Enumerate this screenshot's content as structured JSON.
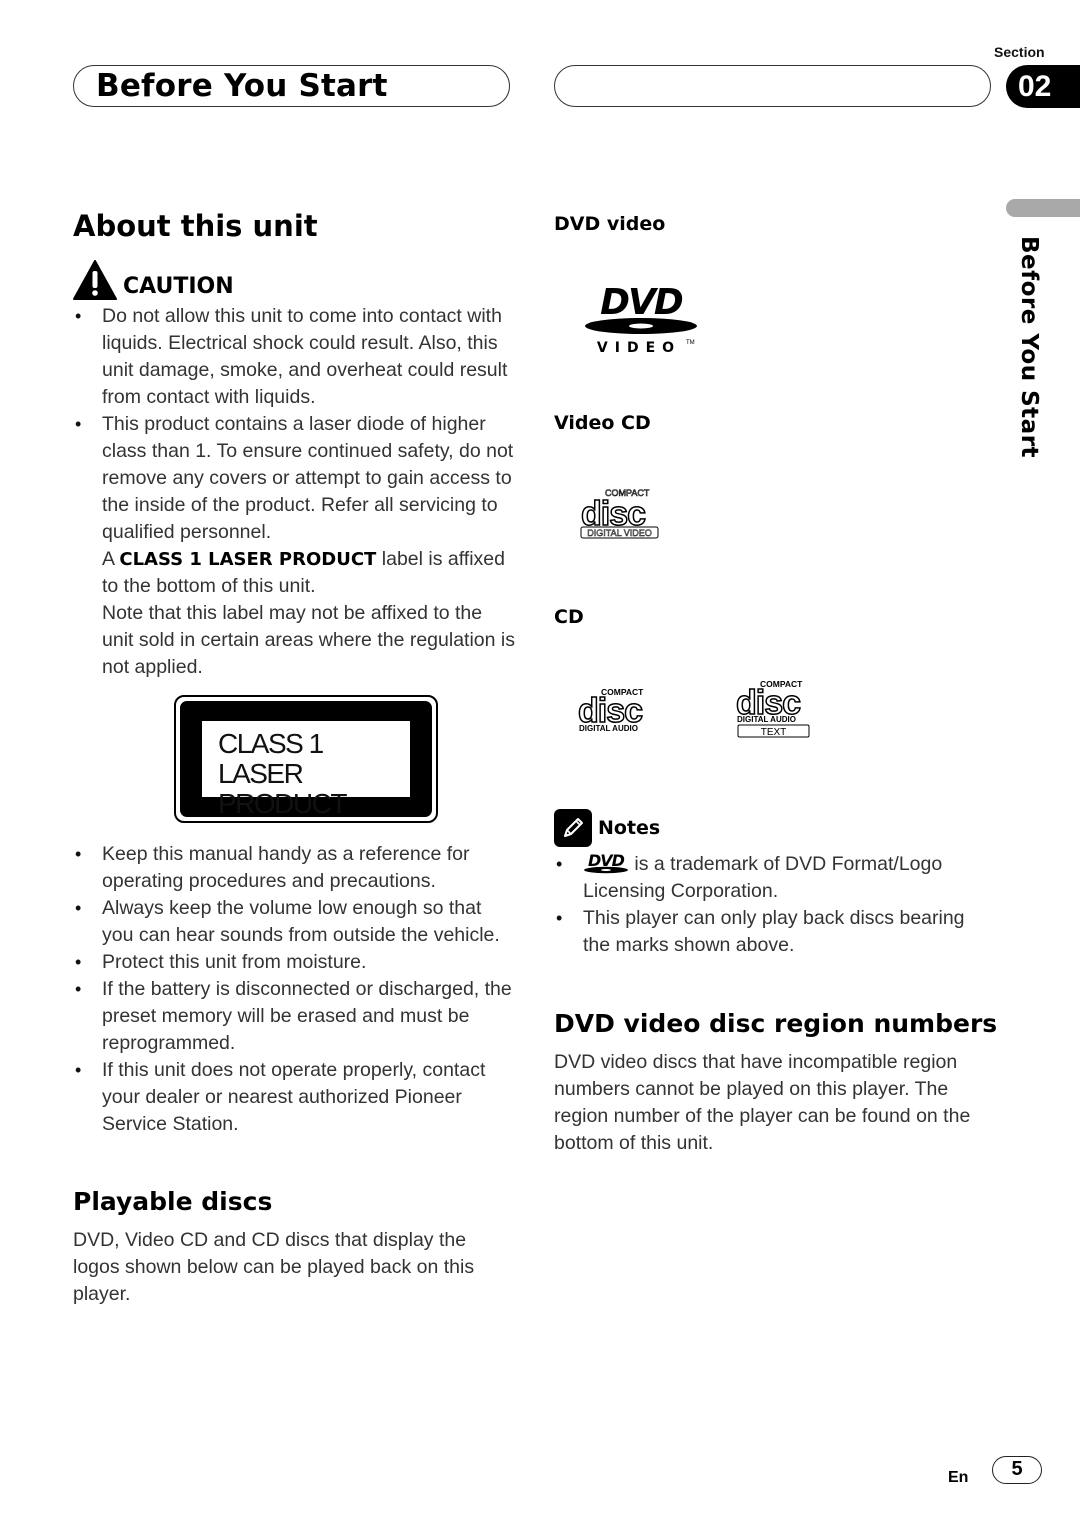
{
  "header": {
    "title": "Before You Start",
    "section_label": "Section",
    "section_number": "02"
  },
  "side_tab": {
    "label": "Before You Start"
  },
  "about": {
    "title": "About this unit",
    "caution_label": "CAUTION",
    "caution_items": [
      "Do not allow this unit to come into contact with liquids. Electrical shock could result. Also, this unit damage, smoke, and overheat could result from contact with liquids.",
      "This product contains a laser diode of higher class than 1. To ensure continued safety, do not remove any covers or attempt to gain access to the inside of the product. Refer all servicing to qualified personnel."
    ],
    "laser_note_prefix": "A ",
    "laser_note_bold": "CLASS 1 LASER PRODUCT",
    "laser_note_suffix": " label is affixed to the bottom of this unit.",
    "label_note": "Note that this label may not be affixed to the unit sold in certain areas where the regulation is not applied.",
    "laser_label": {
      "line1": "CLASS 1",
      "line2": "LASER PRODUCT"
    },
    "general_items": [
      "Keep this manual handy as a reference for operating procedures and precautions.",
      "Always keep the volume low enough so that you can hear sounds from outside the vehicle.",
      "Protect this unit from moisture.",
      "If the battery is disconnected or discharged, the preset memory will be erased and must be reprogrammed.",
      "If this unit does not operate properly, contact your dealer or nearest authorized Pioneer Service Station."
    ]
  },
  "playable": {
    "title": "Playable discs",
    "text": "DVD, Video CD and CD discs that display the logos shown below can be played back on this player."
  },
  "disc_types": {
    "dvd_video": {
      "heading": "DVD video",
      "logo_main": "DVD",
      "logo_sub": "VIDEO",
      "logo_tm": "TM"
    },
    "video_cd": {
      "heading": "Video CD",
      "logo_top": "COMPACT",
      "logo_main": "disc",
      "logo_bottom": "DIGITAL VIDEO"
    },
    "cd": {
      "heading": "CD",
      "logo1": {
        "top": "COMPACT",
        "main": "disc",
        "bottom": "DIGITAL AUDIO"
      },
      "logo2": {
        "top": "COMPACT",
        "main": "disc",
        "bottom": "DIGITAL AUDIO",
        "extra": "TEXT"
      }
    }
  },
  "notes": {
    "label": "Notes",
    "items": [
      "is a trademark of DVD Format/Logo Licensing Corporation.",
      "This player can only play back discs bearing the marks shown above."
    ]
  },
  "region": {
    "title": "DVD video disc region numbers",
    "text": "DVD video discs that have incompatible region numbers cannot be played on this player. The region number of the player can be found on the bottom of this unit."
  },
  "footer": {
    "language": "En",
    "page_number": "5"
  }
}
